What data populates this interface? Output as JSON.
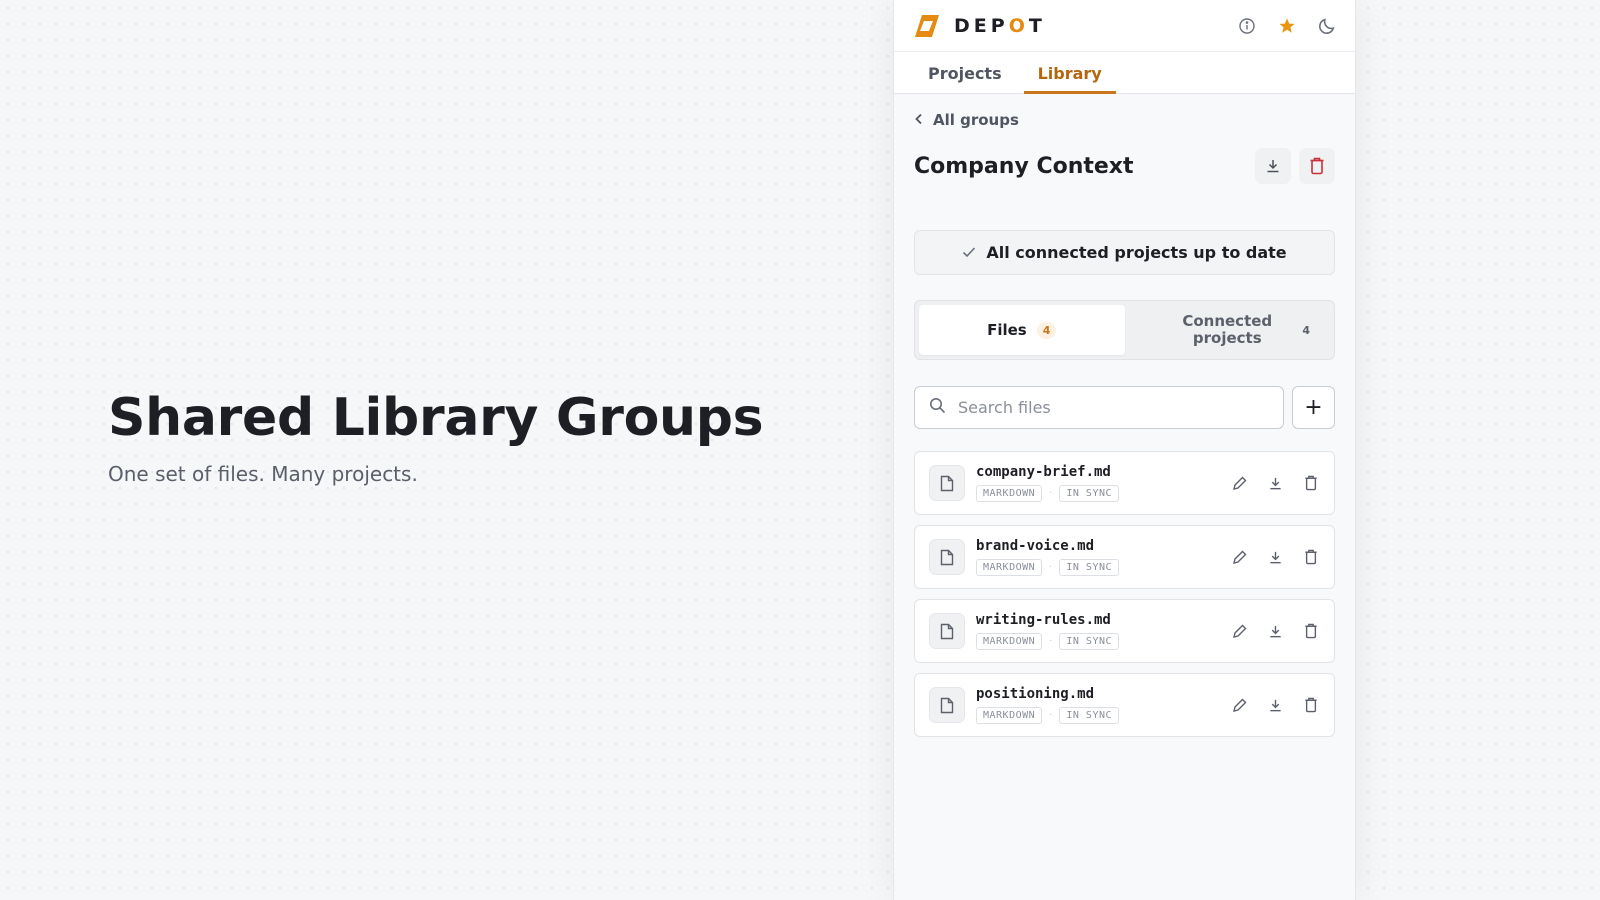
{
  "hero": {
    "title": "Shared Library Groups",
    "subtitle": "One set of files. Many projects."
  },
  "app": {
    "brand_prefix": "DEP",
    "brand_accent": "O",
    "brand_suffix": "T",
    "accent_color": "#e58a12",
    "top_icons": [
      "info-icon",
      "star-icon",
      "moon-icon"
    ]
  },
  "nav": {
    "tabs": [
      {
        "label": "Projects",
        "active": false
      },
      {
        "label": "Library",
        "active": true
      }
    ]
  },
  "library": {
    "back_label": "All groups",
    "group_title": "Company Context",
    "status_text": "All connected projects up to date",
    "segments": [
      {
        "label": "Files",
        "count": "4",
        "active": true
      },
      {
        "label": "Connected projects",
        "count": "4",
        "active": false
      }
    ],
    "search_placeholder": "Search files",
    "add_label": "+",
    "files": [
      {
        "name": "company-brief.md",
        "type": "MARKDOWN",
        "status": "IN SYNC"
      },
      {
        "name": "brand-voice.md",
        "type": "MARKDOWN",
        "status": "IN SYNC"
      },
      {
        "name": "writing-rules.md",
        "type": "MARKDOWN",
        "status": "IN SYNC"
      },
      {
        "name": "positioning.md",
        "type": "MARKDOWN",
        "status": "IN SYNC"
      }
    ]
  }
}
